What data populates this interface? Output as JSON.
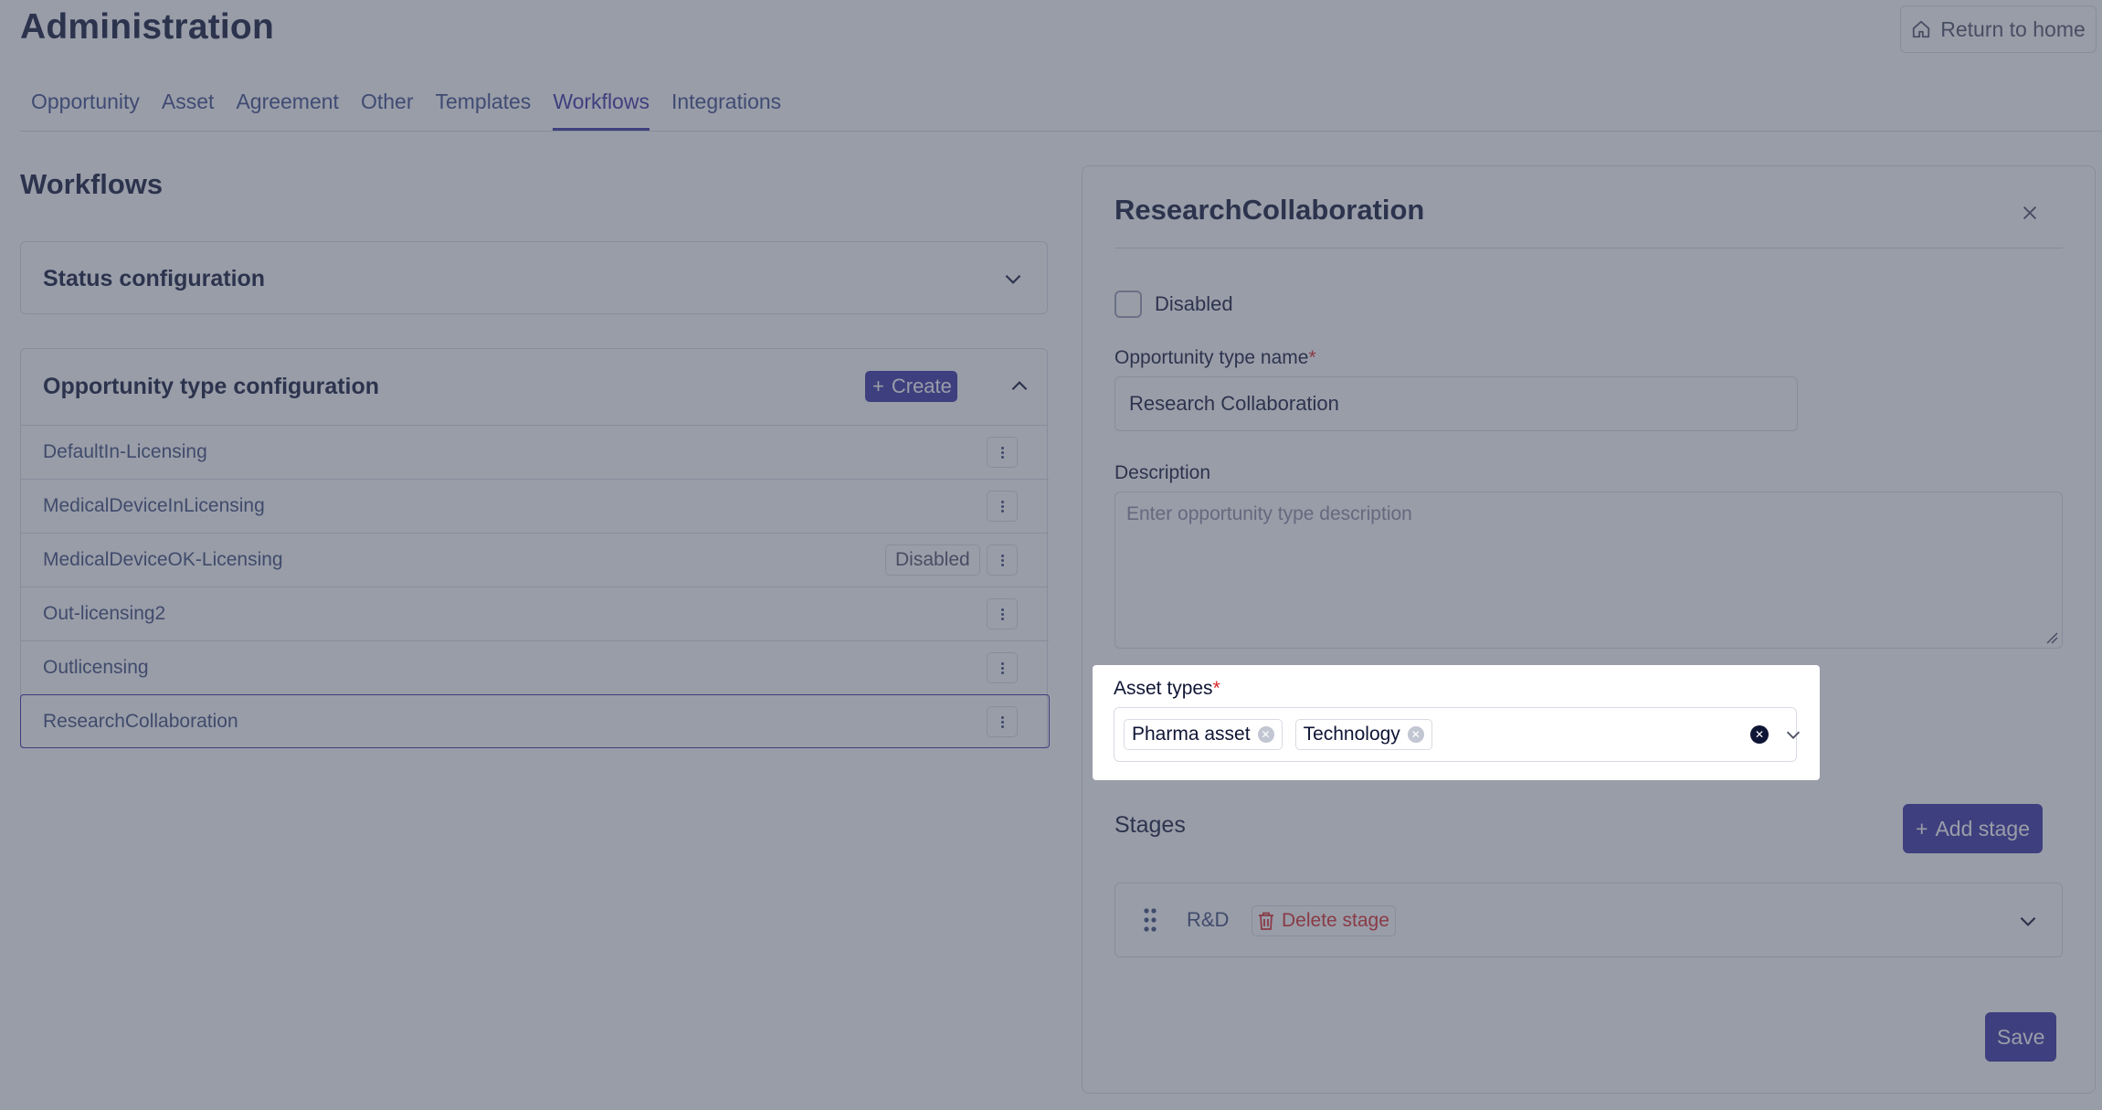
{
  "header": {
    "title": "Administration",
    "return_home": "Return to home"
  },
  "tabs": [
    {
      "label": "Opportunity",
      "active": false
    },
    {
      "label": "Asset",
      "active": false
    },
    {
      "label": "Agreement",
      "active": false
    },
    {
      "label": "Other",
      "active": false
    },
    {
      "label": "Templates",
      "active": false
    },
    {
      "label": "Workflows",
      "active": true
    },
    {
      "label": "Integrations",
      "active": false
    }
  ],
  "workflows": {
    "title": "Workflows",
    "status_configuration": "Status configuration",
    "opportunity_type_configuration": {
      "title": "Opportunity type configuration",
      "create_label": "Create",
      "items": [
        {
          "name": "DefaultIn-Licensing",
          "badge": ""
        },
        {
          "name": "MedicalDeviceInLicensing",
          "badge": ""
        },
        {
          "name": "MedicalDeviceOK-Licensing",
          "badge": "Disabled"
        },
        {
          "name": "Out-licensing2",
          "badge": ""
        },
        {
          "name": "Outlicensing",
          "badge": ""
        },
        {
          "name": "ResearchCollaboration",
          "badge": "",
          "selected": true
        }
      ]
    }
  },
  "panel": {
    "title": "ResearchCollaboration",
    "disabled_label": "Disabled",
    "name_label": "Opportunity type name",
    "name_value": "Research Collaboration",
    "description_label": "Description",
    "description_placeholder": "Enter opportunity type description",
    "asset_types_label": "Asset types",
    "asset_types": [
      "Pharma asset",
      "Technology"
    ],
    "stages_title": "Stages",
    "add_stage_label": "Add stage",
    "stages": [
      {
        "name": "R&D",
        "delete_label": "Delete stage"
      }
    ],
    "save_label": "Save"
  },
  "colors": {
    "primary": "#3730a3",
    "danger": "#dc2626",
    "text": "#0f1535",
    "overlay": "#464c60"
  }
}
